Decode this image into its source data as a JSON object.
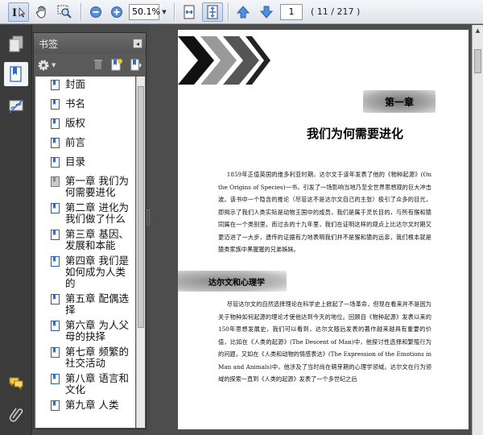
{
  "toolbar": {
    "zoom_value": "50.1%",
    "page_number": "1",
    "page_total": "( 11 / 217 )"
  },
  "panel": {
    "title": "书签",
    "close_glyph": "◂"
  },
  "bookmarks": [
    "封面",
    "书名",
    "版权",
    "前言",
    "目录",
    "第一章 我们为何需要进化",
    "第二章 进化为我们做了什么",
    "第三章 基因、发展和本能",
    "第四章 我们是如何成为人类的",
    "第五章 配偶选择",
    "第六章 为人父母的抉择",
    "第七章 频繁的社交活动",
    "第八章 语言和文化",
    "第九章 人类"
  ],
  "document": {
    "chapter_label": "第一章",
    "chapter_title": "我们为何需要进化",
    "paragraph1": "1859年正值英国的维多利亚时期，达尔文于该年发表了他的《物种起源》(On the Origins of Species)一书，引发了一场影响当地乃至全世界思想观的巨大冲击波。该书中一个隐含的推论（尽管这不是达尔文自己的主张）极引了众多的目光，即揭示了我们人类实际是动物王国中的成员，我们是属于灵长目的，与所有猴和猿同属在一个类别里。而过去的十九年里，我们在证明这样的观点上比达尔文时期又更迈进了一大步，遗传的证据有力地表明我们并不是猴和猿的远亲，我们根本就是猿类家族中黑猩猩的兄弟姊妹。",
    "section_title": "达尔文和心理学",
    "paragraph2": "尽管达尔文的自然选择理论在科学史上掀起了一场革命，但现在看来并不是因为关于物种如何起源的理论才使他达到今天的地位。回顾自《物种起源》发表以来的150年思想发展史，我们可以看到，达尔文随后发表的著作越来越具有重要的价值，比如在《人类的起源》(The Descent of Man)中，他探讨性选择和繁殖行为的问题，又如在《人类和动物的情感表达》(The Expression of the Emotions in Man and Animals)中，他涉及了当时尚在萌芽期的心理学领域。达尔文在行为领域的探索一直到《人类的起源》发表了一个多世纪之后"
  },
  "colors": {
    "toolbar_bg": "#e6e9ee",
    "panel_bg": "#5a5a5a",
    "doc_bg": "#4d4d4d",
    "accent_blue": "#3a78c8"
  }
}
